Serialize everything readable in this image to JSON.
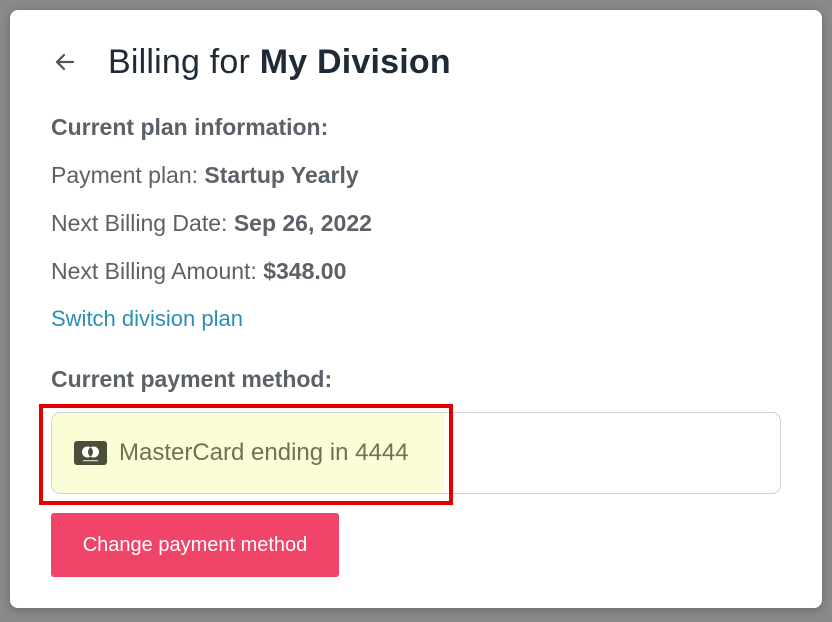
{
  "header": {
    "title_prefix": "Billing for",
    "title_strong": "My Division"
  },
  "plan": {
    "heading": "Current plan information:",
    "payment_plan_label": "Payment plan:",
    "payment_plan_value": "Startup Yearly",
    "next_date_label": "Next Billing Date:",
    "next_date_value": "Sep 26, 2022",
    "next_amount_label": "Next Billing Amount:",
    "next_amount_value": "$348.00",
    "switch_link": "Switch division plan"
  },
  "payment": {
    "heading": "Current payment method:",
    "card_label": "MasterCard ending in 4444",
    "card_icon": "mastercard-icon",
    "change_button": "Change payment method"
  },
  "colors": {
    "title": "#1f2a37",
    "text": "#5b6168",
    "link": "#2a8fb5",
    "card_highlight_bg": "#fbfdd6",
    "button_bg": "#f04469",
    "annotation_border": "#e00000"
  }
}
